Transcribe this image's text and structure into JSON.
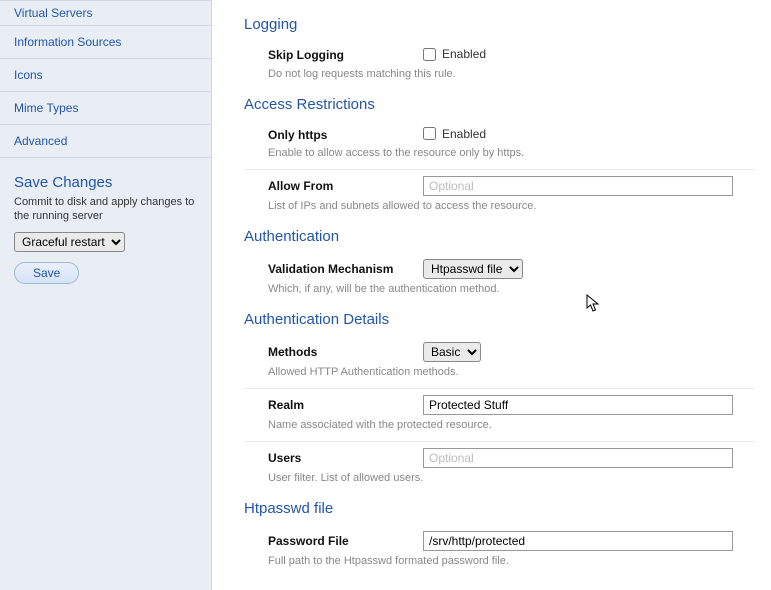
{
  "sidebar": {
    "items": [
      {
        "label": "Virtual Servers"
      },
      {
        "label": "Information Sources"
      },
      {
        "label": "Icons"
      },
      {
        "label": "Mime Types"
      },
      {
        "label": "Advanced"
      }
    ],
    "save": {
      "title": "Save Changes",
      "desc": "Commit to disk and apply changes to the running server",
      "select": "Graceful restart",
      "button": "Save"
    }
  },
  "logging": {
    "title": "Logging",
    "skip_label": "Skip Logging",
    "enabled_label": "Enabled",
    "skip_desc": "Do not log requests matching this rule."
  },
  "access": {
    "title": "Access Restrictions",
    "only_https_label": "Only https",
    "enabled_label": "Enabled",
    "only_https_desc": "Enable to allow access to the resource only by https.",
    "allow_from_label": "Allow From",
    "allow_from_placeholder": "Optional",
    "allow_from_desc": "List of IPs and subnets allowed to access the resource."
  },
  "auth": {
    "title": "Authentication",
    "mechanism_label": "Validation Mechanism",
    "mechanism_value": "Htpasswd file",
    "mechanism_desc": "Which, if any, will be the authentication method."
  },
  "details": {
    "title": "Authentication Details",
    "methods_label": "Methods",
    "methods_value": "Basic",
    "methods_desc": "Allowed HTTP Authentication methods.",
    "realm_label": "Realm",
    "realm_value": "Protected Stuff",
    "realm_desc": "Name associated with the protected resource.",
    "users_label": "Users",
    "users_placeholder": "Optional",
    "users_desc": "User filter. List of allowed users."
  },
  "htpasswd": {
    "title": "Htpasswd file",
    "pwfile_label": "Password File",
    "pwfile_value": "/srv/http/protected",
    "pwfile_desc": "Full path to the Htpasswd formated password file."
  }
}
